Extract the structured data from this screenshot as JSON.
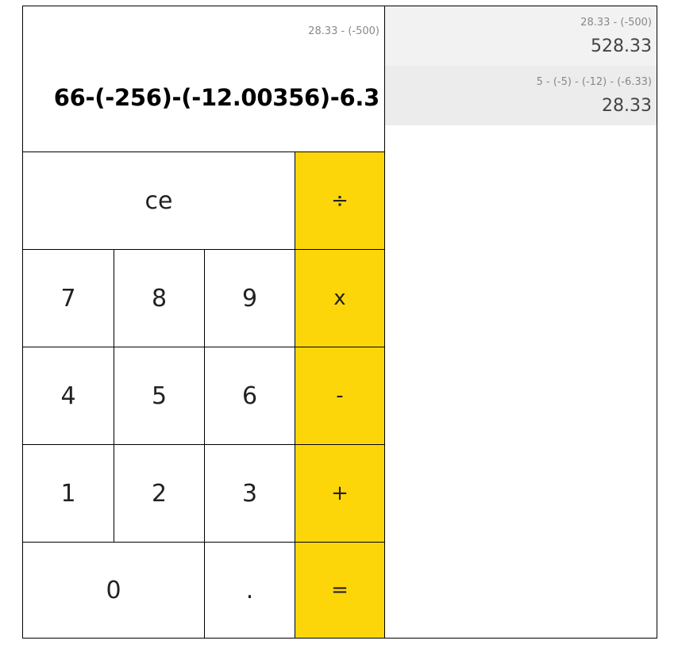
{
  "display": {
    "previous_expression": "28.33 - (-500)",
    "current_expression": "66-(-256)-(-12.00356)-6.3"
  },
  "keys": {
    "clear": "ce",
    "divide": "÷",
    "multiply": "x",
    "subtract": "-",
    "add": "+",
    "equals": "=",
    "decimal": ".",
    "digits": {
      "d0": "0",
      "d1": "1",
      "d2": "2",
      "d3": "3",
      "d4": "4",
      "d5": "5",
      "d6": "6",
      "d7": "7",
      "d8": "8",
      "d9": "9"
    }
  },
  "history": [
    {
      "expression": "28.33 - (-500)",
      "result": "528.33"
    },
    {
      "expression": "5 - (-5) - (-12) - (-6.33)",
      "result": "28.33"
    }
  ],
  "colors": {
    "operator_key": "#fdd60a",
    "history_bg": "#f2f2f2"
  }
}
